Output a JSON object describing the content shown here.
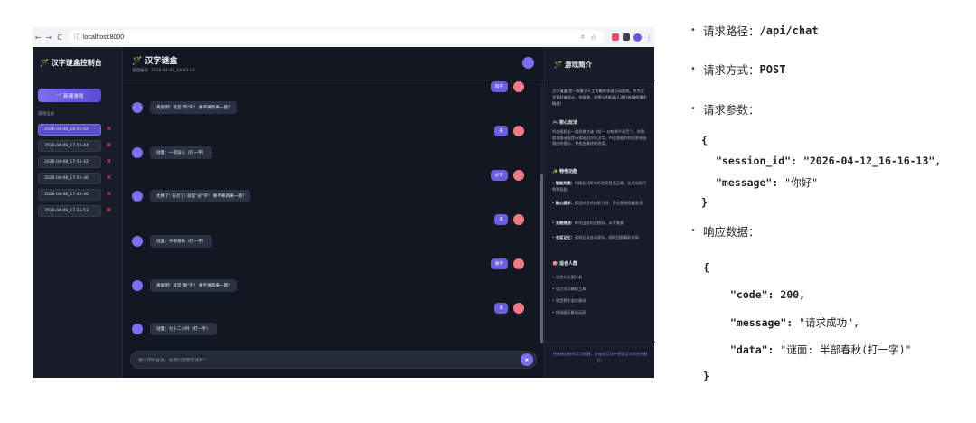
{
  "browser": {
    "nav": {
      "back": "←",
      "forward": "→",
      "reload": "C"
    },
    "url": "localhost:8000",
    "icons": [
      "zoom-icon",
      "star-icon",
      "extension-icon",
      "puzzle-icon",
      "profile-icon",
      "menu-icon"
    ]
  },
  "sidebar": {
    "title": "🪄 汉字谜盒控制台",
    "new_game_button": "🪄 新建游戏",
    "history_label": "游戏记录",
    "history": [
      "2026-04-08_18-02-02",
      "2026-04-08_17-52-44",
      "2026-04-08_17-51-42",
      "2026-04-08_17-50-36",
      "2026-04-08_17-49-36",
      "2026-04-08_17-33-53"
    ],
    "delete_glyph": "✕"
  },
  "main": {
    "title": "🪄 汉字谜盒",
    "session": "会话编号: 2026-04-08_18-02-02",
    "messages": [
      {
        "role": "user",
        "text": "肉字"
      },
      {
        "role": "bot",
        "text": "真聪明！就是\"肉\"字！ 要不要再来一题?"
      },
      {
        "role": "user",
        "text": "来"
      },
      {
        "role": "bot",
        "text": "谜面：一箭穿心（打一字）"
      },
      {
        "role": "user",
        "text": "必字"
      },
      {
        "role": "bot",
        "text": "太棒了! 答对了! 就是\"必\"字！ 要不要再来一题?"
      },
      {
        "role": "user",
        "text": "来"
      },
      {
        "role": "bot",
        "text": "谜面：半部春秋（打一字）"
      },
      {
        "role": "user",
        "text": "秦字"
      },
      {
        "role": "bot",
        "text": "真聪明！就是\"秦\"字！ 要不要再来一题?"
      },
      {
        "role": "user",
        "text": "来"
      },
      {
        "role": "bot",
        "text": "谜面：七十二小时（打一字）"
      }
    ],
    "input_placeholder": "输入你的答案，或者问我要新谜目~",
    "send_glyph": "➤"
  },
  "intro_panel": {
    "title": "🪄 游戏简介",
    "intro": "汉字谜盒 是一款基于人工智能的字谜互动游戏。专为汉字爱好者设计，你说答，你将与AI机器人进行有趣的猜字挑战！",
    "core_heading": "🎮 核心玩法",
    "core_text": "AI会随机出一道经典字谜（如\"一口咬掉牛尾巴\"），你需要根据谜面提示猜出对应的汉字。AI会根据你的回答给出相应的提示，并给出最终的答案。",
    "features_heading": "✨ 特色功能",
    "features": [
      {
        "name": "智能判题：",
        "text": "AI精准判断你的答案是否正确，告对你即可得到鼓励"
      },
      {
        "name": "贴心提示：",
        "text": "猜错时提供线索引导，不会直接透露答案"
      },
      {
        "name": "无限挑战：",
        "text": "每次出题均会随机，永不重复"
      },
      {
        "name": "会话记忆：",
        "text": "游戏记录自动保存，随时回顾精彩对局"
      }
    ],
    "audience_heading": "🎯 适合人群",
    "audience": [
      "汉字文化爱好者",
      "语文学习辅助工具",
      "课堂教学游戏素材",
      "休闲娱乐解谜玩家"
    ],
    "footer": "快来挑战你的汉字智慧，在轻松互动中感受汉字的无穷魅力！"
  },
  "api_doc": {
    "path_label": "请求路径：",
    "path": "/api/chat",
    "method_label": "请求方式：",
    "method": "POST",
    "params_label": "请求参数：",
    "params_open": "{",
    "params_line1_key": "\"session_id\": ",
    "params_line1_val": "\"2026-04-12_16-16-13\",",
    "params_line2_key": "\"message\": ",
    "params_line2_val": "\"你好\"",
    "params_close": "}",
    "response_label": "响应数据：",
    "resp_open": "{",
    "resp_line1_key": "\"code\": ",
    "resp_line1_val": "200,",
    "resp_line2_key": "\"message\": ",
    "resp_line2_val": "\"请求成功\",",
    "resp_line3_key": "\"data\": ",
    "resp_line3_val": "\"谜面: 半部春秋(打一字)\"",
    "resp_close": "}",
    "bullet": "•"
  },
  "colors": {
    "accent": "#7b6ff2",
    "app_bg": "#121722",
    "panel_bg": "#171c28",
    "delete": "#ff4d6d",
    "user_avatar": "#f07a8a"
  }
}
